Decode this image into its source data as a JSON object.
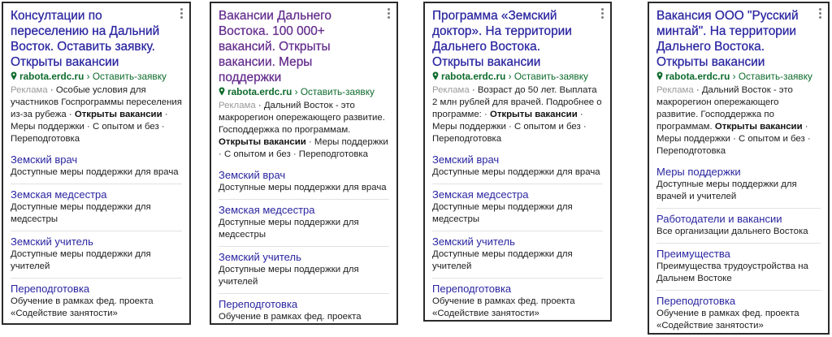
{
  "cards": [
    {
      "title": "Консултации по переселению на Дальний Восток. Оставить заявку. Открыты вакансии",
      "domain": "rabota.erdc.ru",
      "separator": "›",
      "cta": "Оставить-заявку",
      "ad_label": "Реклама",
      "desc_before": "Особые условия для участников Госпрограммы переселения из-за рубежа",
      "desc_bold": "Открыты вакансии",
      "desc_after": "Меры поддержки · С опытом и без · Переподготовка",
      "sitelinks": [
        {
          "title": "Земский врач",
          "desc": "Доступные меры поддержки для врача"
        },
        {
          "title": "Земская медсестра",
          "desc": "Доступные меры поддержки для медсестры"
        },
        {
          "title": "Земский учитель",
          "desc": "Доступные меры поддержки для учителей"
        },
        {
          "title": "Переподготовка",
          "desc": "Обучение в рамках фед. проекта «Содействие занятости»"
        }
      ]
    },
    {
      "title": "Вакансии Дальнего Востока. 100 000+ вакансий. Открыты вакансии. Меры поддержки",
      "domain": "rabota.erdc.ru",
      "separator": "›",
      "cta": "Оставить-заявку",
      "ad_label": "Реклама",
      "desc_before": "Дальний Восток - это макрорегион опережающего развитие. Господдержка по программам.",
      "desc_bold": "Открыты вакансии",
      "desc_after": "Меры поддержки · С опытом и без · Переподготовка",
      "sitelinks": [
        {
          "title": "Земский врач",
          "desc": "Доступные меры поддержки для врача"
        },
        {
          "title": "Земская медсестра",
          "desc": "Доступные меры поддержки для медсестры"
        },
        {
          "title": "Земский учитель",
          "desc": "Доступные меры поддержки для учителей"
        },
        {
          "title": "Переподготовка",
          "desc": "Обучение в рамках фед. проекта «Содействие занятости»"
        }
      ]
    },
    {
      "title": "Программа «Земский доктор». На территории Дальнего Востока. Открыты вакансии",
      "domain": "rabota.erdc.ru",
      "separator": "›",
      "cta": "Оставить-заявку",
      "ad_label": "Реклама",
      "desc_before": "Возраст до 50 лет. Выплата 2 млн рублей для врачей. Подробнее о программе:",
      "desc_bold": "Открыты вакансии",
      "desc_after": "Меры поддержки · С опытом и без · Переподготовка",
      "sitelinks": [
        {
          "title": "Земский врач",
          "desc": "Доступные меры поддержки для врача"
        },
        {
          "title": "Земская медсестра",
          "desc": "Доступные меры поддержки для медсестры"
        },
        {
          "title": "Земский учитель",
          "desc": "Доступные меры поддержки для учителей"
        },
        {
          "title": "Переподготовка",
          "desc": "Обучение в рамках фед. проекта «Содействие занятости»"
        }
      ]
    },
    {
      "title": "Вакансия ООО \"Русский минтай\". На территории Дальнего Востока. Открыты вакансии",
      "domain": "rabota.erdc.ru",
      "separator": "›",
      "cta": "Оставить-заявку",
      "ad_label": "Реклама",
      "desc_before": "Дальний Восток - это макрорегион опережающего развитие. Господдержка по программам.",
      "desc_bold": "Открыты вакансии",
      "desc_after": "Меры поддержки · С опытом и без · Переподготовка",
      "sitelinks": [
        {
          "title": "Меры поддержки",
          "desc": "Доступные меры поддержки для врачей и учителей"
        },
        {
          "title": "Работодатели и вакансии",
          "desc": "Все организации дальнего Востока"
        },
        {
          "title": "Преимущества",
          "desc": "Преимущества трудоустройства на Дальнем Востоке"
        },
        {
          "title": "Переподготовка",
          "desc": "Обучение в рамках фед. проекта «Содействие занятости»"
        }
      ]
    }
  ],
  "colors": {
    "title_blue": "#2a25a0",
    "title_purple": "#652e8e",
    "domain_green": "#0e6b2c",
    "muted_gray": "#9a9a9a"
  }
}
